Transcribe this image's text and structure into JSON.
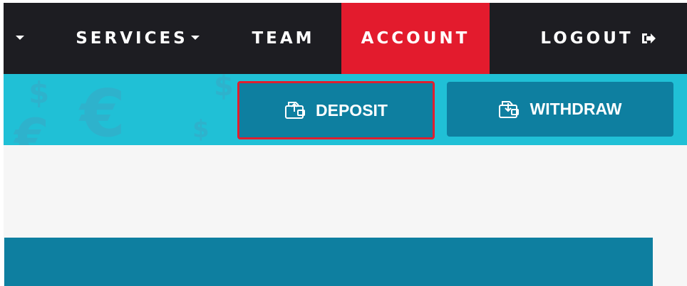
{
  "nav": {
    "items": [
      {
        "label": "SERVICES"
      },
      {
        "label": "TEAM"
      },
      {
        "label": "ACCOUNT"
      },
      {
        "label": "LOGOUT"
      }
    ]
  },
  "actions": {
    "deposit_label": "DEPOSIT",
    "withdraw_label": "WITHDRAW"
  },
  "banner_symbols": [
    "$",
    "€",
    "$",
    "€",
    "$"
  ],
  "colors": {
    "nav_bg": "#1d1d22",
    "nav_active": "#e31b2d",
    "banner": "#20c0d6",
    "button": "#0e7fa0",
    "highlight": "#e01e2e",
    "content_bg": "#f6f6f6"
  },
  "icons": {
    "dropdown": "caret-down-icon",
    "logout": "logout-icon",
    "deposit": "wallet-deposit-icon",
    "withdraw": "wallet-withdraw-icon"
  }
}
